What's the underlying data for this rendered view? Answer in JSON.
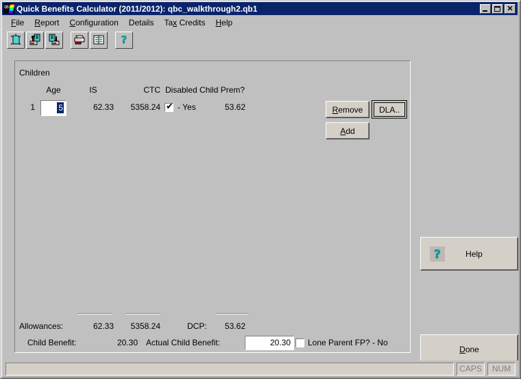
{
  "window": {
    "title": "Quick Benefits Calculator (2011/2012): qbc_walkthrough2.qb1",
    "app_icon": "qbc-app-icon",
    "icon_text": "QB15",
    "buttons": {
      "minimize": "minimize-button",
      "maximize": "maximize-button",
      "close_label": "✕"
    }
  },
  "menubar": {
    "items": [
      {
        "label": "File",
        "accel": "F"
      },
      {
        "label": "Report",
        "accel": "R"
      },
      {
        "label": "Configuration",
        "accel": "C"
      },
      {
        "label": "Details",
        "accel": ""
      },
      {
        "label": "Tax Credits",
        "accel": "x"
      },
      {
        "label": "Help",
        "accel": "H"
      }
    ]
  },
  "toolbar": {
    "buttons": [
      {
        "name": "new-document-icon",
        "title": "New"
      },
      {
        "name": "open-document-icon",
        "title": "Open"
      },
      {
        "name": "save-document-icon",
        "title": "Save"
      },
      {
        "name": "print-icon",
        "title": "Print"
      },
      {
        "name": "report-book-icon",
        "title": "Report"
      },
      {
        "name": "help-question-icon",
        "title": "Help"
      }
    ]
  },
  "children_group": {
    "legend": "Children",
    "headers": {
      "age": "Age",
      "is": "IS",
      "ctc": "CTC",
      "dcp": "Disabled Child Prem?"
    },
    "rows": [
      {
        "index": "1",
        "age": "5",
        "is": "62.33",
        "ctc": "5358.24",
        "dcp_checked": true,
        "dcp_label": "- Yes",
        "dcp_amount": "53.62"
      }
    ],
    "actions": {
      "remove": {
        "pre": "R",
        "post": "emove"
      },
      "dla": "DLA..",
      "add": {
        "pre": "A",
        "post": "dd"
      }
    }
  },
  "totals": {
    "allowances_label": "Allowances:",
    "allowances_is": "62.33",
    "allowances_ctc": "5358.24",
    "dcp_label": "DCP:",
    "dcp_value": "53.62",
    "child_benefit_label": "Child Benefit:",
    "child_benefit_value": "20.30",
    "actual_child_benefit_label": "Actual Child Benefit:",
    "actual_child_benefit_value": "20.30",
    "lone_parent_label": "Lone Parent FP? - No",
    "lone_parent_checked": false
  },
  "side_buttons": {
    "help": "Help",
    "done": {
      "pre": "D",
      "post": "one"
    }
  },
  "statusbar": {
    "message": "",
    "caps": "CAPS",
    "num": "NUM"
  },
  "colors": {
    "titlebar": "#0a246a",
    "face": "#c0c0c0",
    "button_face": "#d4d0c8",
    "selection": "#0a246a",
    "icon_teal": "#008080",
    "icon_cyan": "#00b3b3"
  }
}
